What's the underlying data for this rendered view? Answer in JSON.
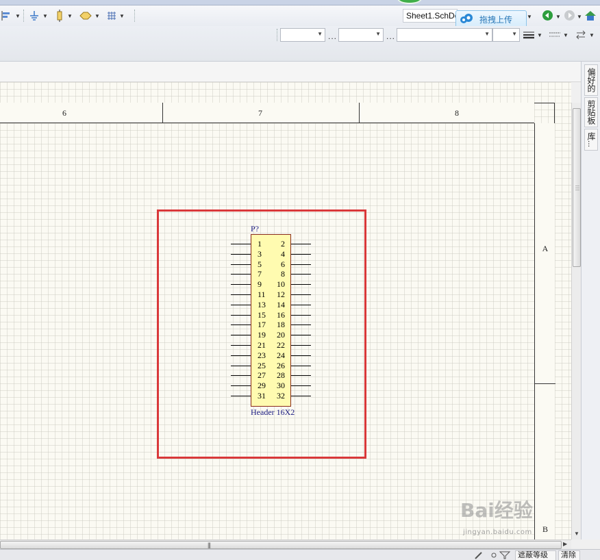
{
  "app": {
    "document_tab": "Sheet1.SchDoc",
    "upload_button": "拖拽上传"
  },
  "toolbar": {
    "items": [
      "align-icon",
      "ground-icon",
      "port-icon",
      "offsheet-icon",
      "grid-icon"
    ],
    "combo_separator": "..."
  },
  "side_panel": {
    "tabs": [
      "偏好的",
      "剪贴板",
      "库..."
    ]
  },
  "sheet": {
    "column_zones": [
      "6",
      "7",
      "8"
    ],
    "row_zones": [
      "A",
      "B"
    ]
  },
  "component": {
    "designator": "P?",
    "comment": "Header 16X2",
    "pins_left": [
      "1",
      "3",
      "5",
      "7",
      "9",
      "11",
      "13",
      "15",
      "17",
      "19",
      "21",
      "23",
      "25",
      "27",
      "29",
      "31"
    ],
    "pins_right": [
      "2",
      "4",
      "6",
      "8",
      "10",
      "12",
      "14",
      "16",
      "18",
      "20",
      "22",
      "24",
      "26",
      "28",
      "30",
      "32"
    ]
  },
  "status_bar": {
    "mask_level": "遮蔽等级",
    "clear": "清除"
  },
  "watermark": {
    "text": "Bai经验",
    "url": "jingyan.baidu.com"
  },
  "colors": {
    "highlight_border": "#d9383a",
    "component_fill": "#fffbb0",
    "designator_text": "#1a1a80"
  }
}
